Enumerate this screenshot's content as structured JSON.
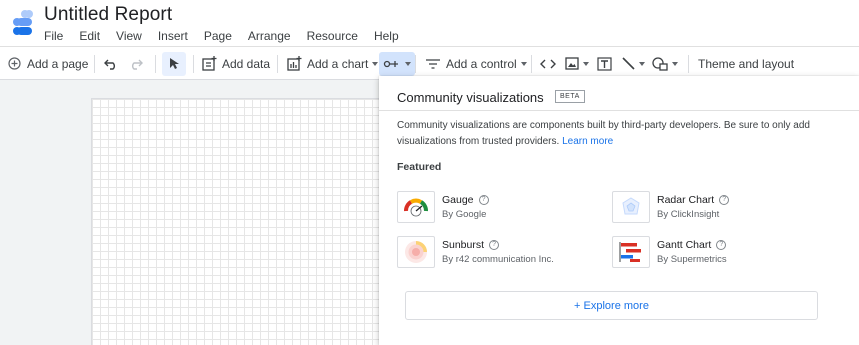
{
  "app": {
    "title": "Untitled Report",
    "menu": [
      "File",
      "Edit",
      "View",
      "Insert",
      "Page",
      "Arrange",
      "Resource",
      "Help"
    ]
  },
  "toolbar": {
    "add_page": "Add a page",
    "add_data": "Add data",
    "add_chart": "Add a chart",
    "add_control": "Add a control",
    "theme_layout": "Theme and layout"
  },
  "panel": {
    "title": "Community visualizations",
    "badge": "BETA",
    "description": "Community visualizations are components built by third-party developers. Be sure to only add visualizations from trusted providers.",
    "learn_more": "Learn more",
    "featured_label": "Featured",
    "items": [
      {
        "name": "Gauge",
        "by": "By Google",
        "icon": "gauge-icon"
      },
      {
        "name": "Radar Chart",
        "by": "By ClickInsight",
        "icon": "radar-chart-icon"
      },
      {
        "name": "Sunburst",
        "by": "By r42 communication Inc.",
        "icon": "sunburst-icon"
      },
      {
        "name": "Gantt Chart",
        "by": "By Supermetrics",
        "icon": "gantt-chart-icon"
      }
    ],
    "explore_more": "+ Explore more"
  },
  "colors": {
    "accent": "#1a73e8",
    "selected_bg": "#d2e3fc"
  }
}
